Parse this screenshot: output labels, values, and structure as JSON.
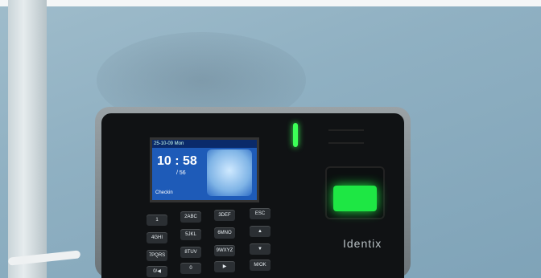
{
  "device": {
    "brand": "Identix",
    "screen": {
      "header": "25-10-09 Mon",
      "time": "10 : 58",
      "subtime": "/ 56",
      "status": "Checkin"
    },
    "keys": [
      "1",
      "2ABC",
      "3DEF",
      "ESC",
      "4GHI",
      "5JKL",
      "6MNO",
      "▲",
      "7PQRS",
      "8TUV",
      "9WXYZ",
      "▼",
      "0/◀",
      "0",
      "▶",
      "M/OK"
    ]
  }
}
